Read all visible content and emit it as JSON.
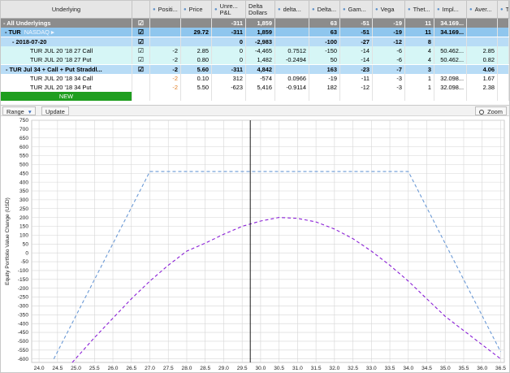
{
  "columns": [
    {
      "key": "underlying",
      "label": "Underlying",
      "left": 0,
      "width": 162,
      "dot": false,
      "center": true
    },
    {
      "key": "check",
      "label": "",
      "left": 162,
      "width": 22,
      "dot": false,
      "center": true
    },
    {
      "key": "position",
      "label": "Positi...",
      "left": 184,
      "width": 38,
      "dot": true
    },
    {
      "key": "price",
      "label": "Price",
      "left": 222,
      "width": 38,
      "dot": true
    },
    {
      "key": "unreal_pl",
      "label": "Unre... P&L",
      "left": 260,
      "width": 42,
      "dot": true
    },
    {
      "key": "delta_dollars",
      "label": "Delta Dollars",
      "left": 302,
      "width": 36,
      "dot": false
    },
    {
      "key": "delta_small",
      "label": "delta...",
      "left": 338,
      "width": 42,
      "dot": true
    },
    {
      "key": "delta",
      "label": "Delta...",
      "left": 380,
      "width": 38,
      "dot": true
    },
    {
      "key": "gamma",
      "label": "Gam...",
      "left": 418,
      "width": 40,
      "dot": true
    },
    {
      "key": "vega",
      "label": "Vega",
      "left": 458,
      "width": 40,
      "dot": true
    },
    {
      "key": "theta",
      "label": "Thet...",
      "left": 498,
      "width": 36,
      "dot": true
    },
    {
      "key": "impl",
      "label": "Impl...",
      "left": 534,
      "width": 40,
      "dot": true
    },
    {
      "key": "aver",
      "label": "Aver...",
      "left": 574,
      "width": 38,
      "dot": true
    },
    {
      "key": "extra",
      "label": "T",
      "left": 612,
      "width": 14,
      "dot": true
    }
  ],
  "rows": [
    {
      "style": "all",
      "cells": {
        "underlying": "- All Underlyings",
        "check": "☑",
        "position": "",
        "price": "",
        "unreal_pl": "-311",
        "delta_dollars": "1,859",
        "delta_small": "",
        "delta": "63",
        "gamma": "-51",
        "vega": "-19",
        "theta": "11",
        "impl": "34.169...",
        "aver": "",
        "extra": ""
      }
    },
    {
      "style": "tur",
      "cells": {
        "underlying": "- TUR",
        "exchange": "NASDAQ",
        "check": "☑",
        "position": "",
        "price": "29.72",
        "unreal_pl": "-311",
        "delta_dollars": "1,859",
        "delta_small": "",
        "delta": "63",
        "gamma": "-51",
        "vega": "-19",
        "theta": "11",
        "impl": "34.169...",
        "aver": "",
        "extra": ""
      }
    },
    {
      "style": "date",
      "cells": {
        "underlying": "- 2018-07-20",
        "check": "☑",
        "position": "",
        "price": "",
        "unreal_pl": "0",
        "delta_dollars": "-2,983",
        "delta_small": "",
        "delta": "-100",
        "gamma": "-27",
        "vega": "-12",
        "theta": "8",
        "impl": "",
        "aver": "",
        "extra": ""
      }
    },
    {
      "style": "leg",
      "cells": {
        "underlying": "TUR JUL 20 '18 27 Call",
        "check": "☑",
        "position": "-2",
        "price": "2.85",
        "unreal_pl": "0",
        "delta_dollars": "-4,465",
        "delta_small": "0.7512",
        "delta": "-150",
        "gamma": "-14",
        "vega": "-6",
        "theta": "4",
        "impl": "50.462...",
        "aver": "2.85",
        "extra": ""
      }
    },
    {
      "style": "leg",
      "cells": {
        "underlying": "TUR JUL 20 '18 27 Put",
        "check": "☑",
        "position": "-2",
        "price": "0.80",
        "unreal_pl": "0",
        "delta_dollars": "1,482",
        "delta_small": "-0.2494",
        "delta": "50",
        "gamma": "-14",
        "vega": "-6",
        "theta": "4",
        "impl": "50.462...",
        "aver": "0.82",
        "extra": ""
      }
    },
    {
      "style": "strat",
      "cells": {
        "underlying": "- TUR Jul 34 + Call + Put Straddl...",
        "check": "☑",
        "position": "-2",
        "price": "5.60",
        "unreal_pl": "-311",
        "delta_dollars": "4,842",
        "delta_small": "",
        "delta": "163",
        "gamma": "-23",
        "vega": "-7",
        "theta": "3",
        "impl": "",
        "aver": "4.06",
        "extra": ""
      }
    },
    {
      "style": "leg2",
      "cells": {
        "underlying": "TUR JUL 20 '18 34 Call",
        "check": "",
        "position": "-2",
        "price": "0.10",
        "unreal_pl": "312",
        "delta_dollars": "-574",
        "delta_small": "0.0966",
        "delta": "-19",
        "gamma": "-11",
        "vega": "-3",
        "theta": "1",
        "impl": "32.098...",
        "aver": "1.67",
        "extra": ""
      }
    },
    {
      "style": "leg2",
      "cells": {
        "underlying": "TUR JUL 20 '18 34 Put",
        "check": "",
        "position": "-2",
        "price": "5.50",
        "unreal_pl": "-623",
        "delta_dollars": "5,416",
        "delta_small": "-0.9114",
        "delta": "182",
        "gamma": "-12",
        "vega": "-3",
        "theta": "1",
        "impl": "32.098...",
        "aver": "2.38",
        "extra": ""
      }
    },
    {
      "style": "new",
      "cells": {
        "underlying": "NEW",
        "check": "",
        "position": "",
        "price": "",
        "unreal_pl": "",
        "delta_dollars": "",
        "delta_small": "",
        "delta": "",
        "gamma": "",
        "vega": "",
        "theta": "",
        "impl": "",
        "aver": "",
        "extra": ""
      }
    }
  ],
  "toolbar": {
    "range_label": "Range",
    "range_arrow": "▾",
    "update_label": "Update",
    "zoom_label": "Zoom",
    "zoom_icon": "magnifier-icon"
  },
  "colors": {
    "header_bg": "#e6e6e6",
    "all_bg": "#8c8c8c",
    "tur_bg": "#8fc6ee",
    "date_bg": "#b8dcf6",
    "leg_bg": "#d6f6f6",
    "strat_bg": "#b8dcf6",
    "leg2_bg": "#ffffff",
    "new_bg": "#1f9e1f",
    "orange": "#e07a1f",
    "grid": "#d6d6d6",
    "dashed_blue": "#6b9ad6",
    "dashed_purple": "#8a1fd6"
  },
  "chart_data": {
    "type": "line",
    "ylabel": "Equity Portfolio Value Change (USD)",
    "xlabel": "",
    "xlim": [
      23.8,
      36.6
    ],
    "ylim": [
      -620,
      750
    ],
    "x_ticks": [
      24.0,
      24.5,
      25.0,
      25.5,
      26.0,
      26.5,
      27.0,
      27.5,
      28.0,
      28.5,
      29.0,
      29.5,
      30.0,
      30.5,
      31.0,
      31.5,
      32.0,
      32.5,
      33.0,
      33.5,
      34.0,
      34.5,
      35.0,
      35.5,
      36.0,
      36.5
    ],
    "y_ticks": [
      750,
      700,
      650,
      600,
      550,
      500,
      450,
      400,
      350,
      300,
      250,
      200,
      150,
      100,
      50,
      0,
      -50,
      -100,
      -150,
      -200,
      -250,
      -300,
      -350,
      -400,
      -450,
      -500,
      -550,
      -600
    ],
    "vertical_marker_x": 29.72,
    "grid": true,
    "legend": "none",
    "series": [
      {
        "style": "dashed-blue",
        "points": [
          [
            24.4,
            -600
          ],
          [
            27.0,
            460
          ],
          [
            34.0,
            460
          ],
          [
            36.5,
            -560
          ]
        ]
      },
      {
        "style": "dashed-purple",
        "points": [
          [
            24.9,
            -620
          ],
          [
            25.5,
            -480
          ],
          [
            26.0,
            -370
          ],
          [
            26.5,
            -260
          ],
          [
            27.0,
            -160
          ],
          [
            27.5,
            -70
          ],
          [
            28.0,
            10
          ],
          [
            28.5,
            55
          ],
          [
            29.0,
            105
          ],
          [
            29.5,
            150
          ],
          [
            30.0,
            180
          ],
          [
            30.5,
            200
          ],
          [
            31.0,
            195
          ],
          [
            31.5,
            175
          ],
          [
            32.0,
            135
          ],
          [
            32.5,
            80
          ],
          [
            33.0,
            10
          ],
          [
            33.5,
            -70
          ],
          [
            34.0,
            -160
          ],
          [
            34.5,
            -260
          ],
          [
            35.0,
            -360
          ],
          [
            35.5,
            -440
          ],
          [
            36.0,
            -520
          ],
          [
            36.5,
            -600
          ]
        ]
      }
    ]
  }
}
